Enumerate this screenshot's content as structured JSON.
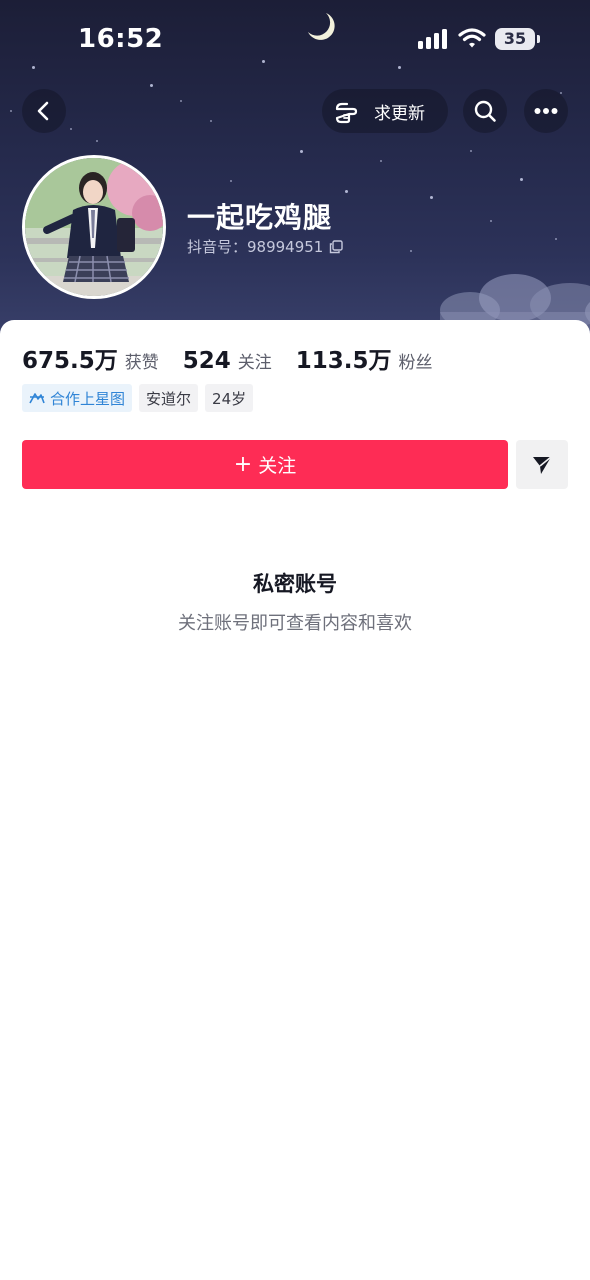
{
  "status_bar": {
    "time": "16:52",
    "battery": "35"
  },
  "header": {
    "request_update_label": "求更新"
  },
  "profile": {
    "nickname": "一起吃鸡腿",
    "douyin_id": "抖音号：98994951"
  },
  "stats": [
    {
      "value": "675.5万",
      "label": "获赞"
    },
    {
      "value": "524",
      "label": "关注"
    },
    {
      "value": "113.5万",
      "label": "粉丝"
    }
  ],
  "tags": [
    {
      "label": "合作上星图",
      "icon": "xingtu-icon"
    },
    {
      "label": "安道尔"
    },
    {
      "label": "24岁"
    }
  ],
  "actions": {
    "follow_plus": "+",
    "follow_label": "关注",
    "share_icon": "send-icon"
  },
  "private": {
    "title": "私密账号",
    "subtitle": "关注账号即可查看内容和喜欢"
  },
  "colors": {
    "accent": "#fe2c55",
    "hero_bg": "#252a4c",
    "tag_blue": "#2f84d6"
  }
}
